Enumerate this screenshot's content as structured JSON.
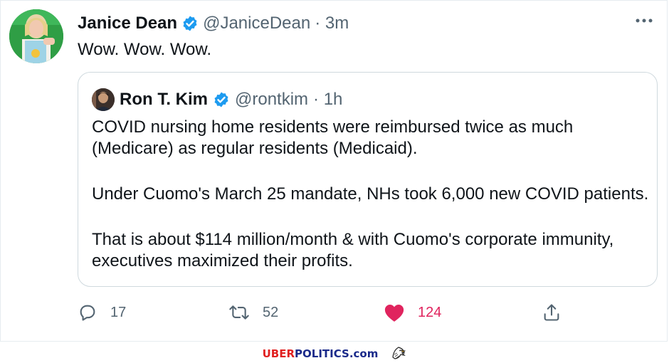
{
  "tweet": {
    "author_name": "Janice Dean",
    "author_handle": "@JaniceDean",
    "time": "· 3m",
    "text": "Wow. Wow. Wow.",
    "more_icon": "more-horizontal-icon"
  },
  "quoted": {
    "author_name": "Ron T. Kim",
    "author_handle": "@rontkim",
    "time": "· 1h",
    "paragraphs": [
      "COVID nursing home residents were reimbursed twice as much (Medicare) as regular residents (Medicaid).",
      "Under Cuomo's March 25 mandate, NHs took 6,000 new COVID patients.",
      "That is about $114 million/month & with Cuomo's corporate immunity, executives maximized their profits."
    ]
  },
  "actions": {
    "replies": "17",
    "retweets": "52",
    "likes": "124",
    "liked": true
  },
  "footer": {
    "brand_part1": "UBER",
    "brand_part2": "POLITICS.com",
    "logo_icon": "eagle-icon"
  },
  "colors": {
    "verified": "#1d9bf0",
    "like": "#e0245e",
    "muted": "#536471",
    "brand_red": "#e02020",
    "brand_blue": "#1a2a8a"
  }
}
